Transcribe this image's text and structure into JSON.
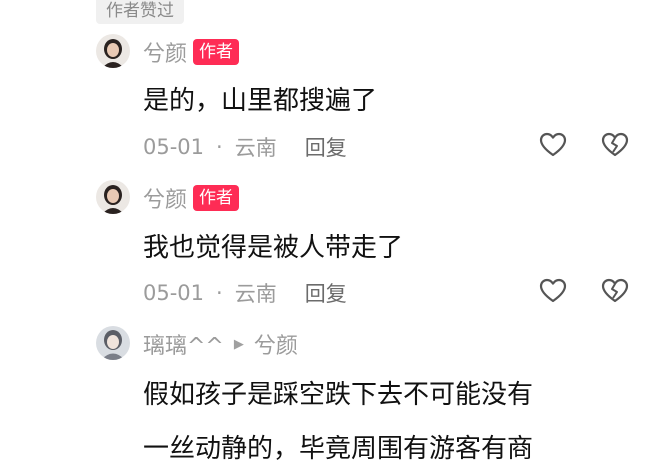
{
  "top_badge": "作者赞过",
  "comments": [
    {
      "username": "兮颜",
      "author_tag": "作者",
      "content": "是的，山里都搜遍了",
      "date": "05-01",
      "location": "云南",
      "reply_label": "回复"
    },
    {
      "username": "兮颜",
      "author_tag": "作者",
      "content": "我也觉得是被人带走了",
      "date": "05-01",
      "location": "云南",
      "reply_label": "回复"
    },
    {
      "username": "璃璃^^",
      "reply_to": "兮颜",
      "content_lines": [
        "假如孩子是踩空跌下去不可能没有",
        "一丝动静的，毕竟周围有游客有商"
      ]
    }
  ],
  "meta_separator": "·",
  "icons": {
    "like": "heart-outline-icon",
    "dislike": "broken-heart-outline-icon",
    "reply_arrow": "triangle-right-icon"
  },
  "colors": {
    "author_tag": "#fe2c55",
    "secondary_text": "#9b9b9b",
    "badge_bg": "#f0f0f0"
  }
}
